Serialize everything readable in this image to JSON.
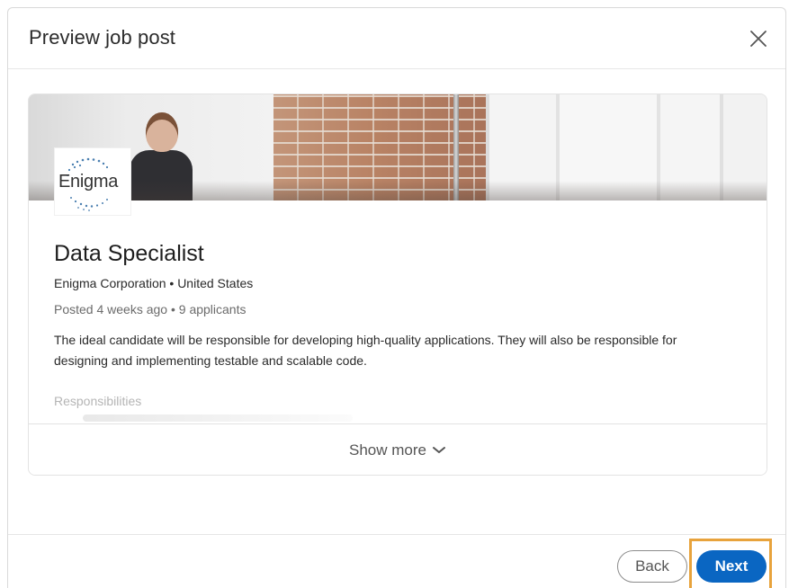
{
  "modal": {
    "title": "Preview job post"
  },
  "job": {
    "logo_text": "Enigma",
    "title": "Data Specialist",
    "company_location": "Enigma Corporation • United States",
    "meta": "Posted 4 weeks ago • 9 applicants",
    "description": "The ideal candidate will be responsible for developing high-quality applications. They will also be responsible for designing and implementing testable and scalable code.",
    "section_heading": "Responsibilities",
    "show_more_label": "Show more"
  },
  "footer": {
    "back_label": "Back",
    "next_label": "Next"
  },
  "colors": {
    "primary": "#0a66c2",
    "highlight": "#e8a33c"
  },
  "icons": {
    "close": "close-icon",
    "chevron": "chevron-down-icon"
  }
}
